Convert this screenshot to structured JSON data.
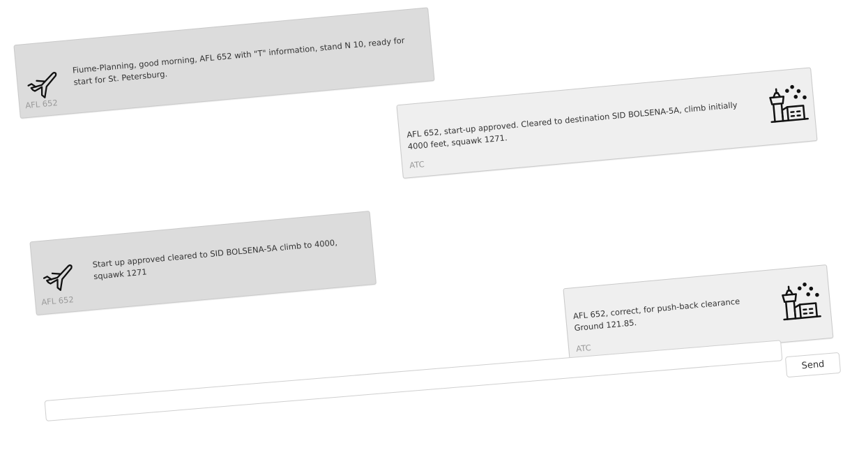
{
  "messages": [
    {
      "sender": "AFL 652",
      "role": "pilot",
      "icon": "airplane-icon",
      "text": "Fiume-Planning, good morning, AFL 652 with \"T\" information, stand N 10, ready for start for St. Petersburg."
    },
    {
      "sender": "ATC",
      "role": "atc",
      "icon": "control-tower-icon",
      "text": "AFL 652, start-up approved. Cleared to destination SID BOLSENA-5A, climb initially 4000 feet, squawk 1271."
    },
    {
      "sender": "AFL 652",
      "role": "pilot",
      "icon": "airplane-icon",
      "text": "Start up approved cleared to SID BOLSENA-5A climb to 4000, squawk 1271"
    },
    {
      "sender": "ATC",
      "role": "atc",
      "icon": "control-tower-icon",
      "text": "AFL 652, correct, for push-back clearance Ground 121.85."
    }
  ],
  "composer": {
    "message_value": "",
    "send_label": "Send"
  },
  "footer_input": {
    "value": ""
  },
  "colors": {
    "pilot_bubble": "#dcdcdc",
    "atc_bubble": "#efefef",
    "sender_text": "#9a9a9a",
    "body_text": "#333333"
  }
}
